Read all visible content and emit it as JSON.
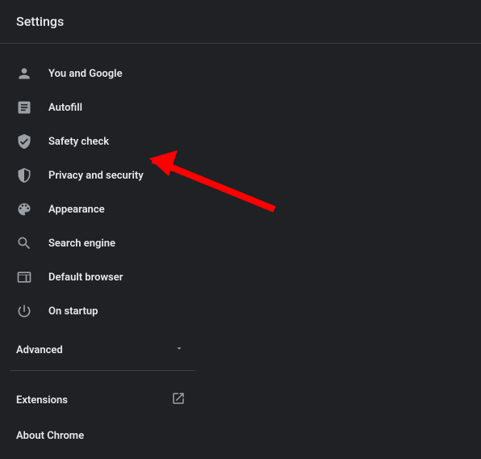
{
  "header": {
    "title": "Settings"
  },
  "sidebar": {
    "items": [
      {
        "label": "You and Google",
        "icon": "person-icon"
      },
      {
        "label": "Autofill",
        "icon": "autofill-icon"
      },
      {
        "label": "Safety check",
        "icon": "safety-check-icon"
      },
      {
        "label": "Privacy and security",
        "icon": "security-icon"
      },
      {
        "label": "Appearance",
        "icon": "palette-icon"
      },
      {
        "label": "Search engine",
        "icon": "search-icon"
      },
      {
        "label": "Default browser",
        "icon": "browser-icon"
      },
      {
        "label": "On startup",
        "icon": "power-icon"
      }
    ],
    "advanced_label": "Advanced",
    "footer": [
      {
        "label": "Extensions",
        "has_open_icon": true
      },
      {
        "label": "About Chrome",
        "has_open_icon": false
      }
    ]
  },
  "annotation": {
    "type": "arrow",
    "color": "#ff0000",
    "target": "Privacy and security"
  }
}
